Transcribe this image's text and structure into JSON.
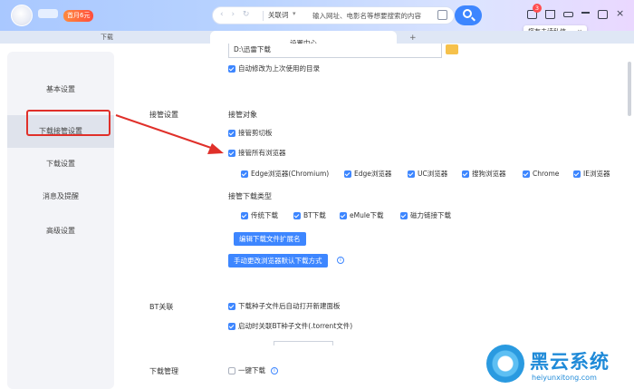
{
  "topbar": {
    "vip_badge": "首月6元",
    "address": {
      "nav_arrows": "‹ › ↻",
      "search_mode": "关联词",
      "placeholder": "输入网址、电影名等想要搜索的内容"
    },
    "mail_count": "3",
    "tooltip": "您有未读私信",
    "tooltip_close": "×"
  },
  "tabs": [
    {
      "label": "下载"
    },
    {
      "label": "设置中心"
    }
  ],
  "sidebar": {
    "items": [
      {
        "label": "基本设置"
      },
      {
        "label": "下载接管设置"
      },
      {
        "label": "下载设置"
      },
      {
        "label": "消息及提醒"
      },
      {
        "label": "高级设置"
      }
    ]
  },
  "main": {
    "directory_value": "D:\\迅雷下载",
    "auto_modify_dir": "自动修改为上次使用的目录",
    "takeover": {
      "section": "接管设置",
      "objects_label": "接管对象",
      "clipboard": "接管剪切板",
      "all_browsers": "接管所有浏览器",
      "browsers": [
        "Edge浏览器(Chromium)",
        "Edge浏览器",
        "UC浏览器",
        "搜狗浏览器",
        "Chrome",
        "IE浏览器"
      ],
      "types_label": "接管下载类型",
      "types": [
        "传统下载",
        "BT下载",
        "eMule下载",
        "磁力链接下载"
      ],
      "edit_ext_button": "编辑下载文件扩展名",
      "manual_change_button": "手动更改浏览器默认下载方式"
    },
    "bt": {
      "section": "BT关联",
      "open_new_panel": "下载种子文件后自动打开新建面板",
      "associate_torrent": "启动时关联BT种子文件(.torrent文件)"
    },
    "download_mgmt": {
      "section": "下载管理",
      "one_click": "一键下载"
    }
  },
  "watermark": {
    "title": "黑云系统",
    "url": "heiyunxitong.com"
  },
  "colors": {
    "accent": "#3d86ff",
    "highlight": "#e0302a"
  }
}
